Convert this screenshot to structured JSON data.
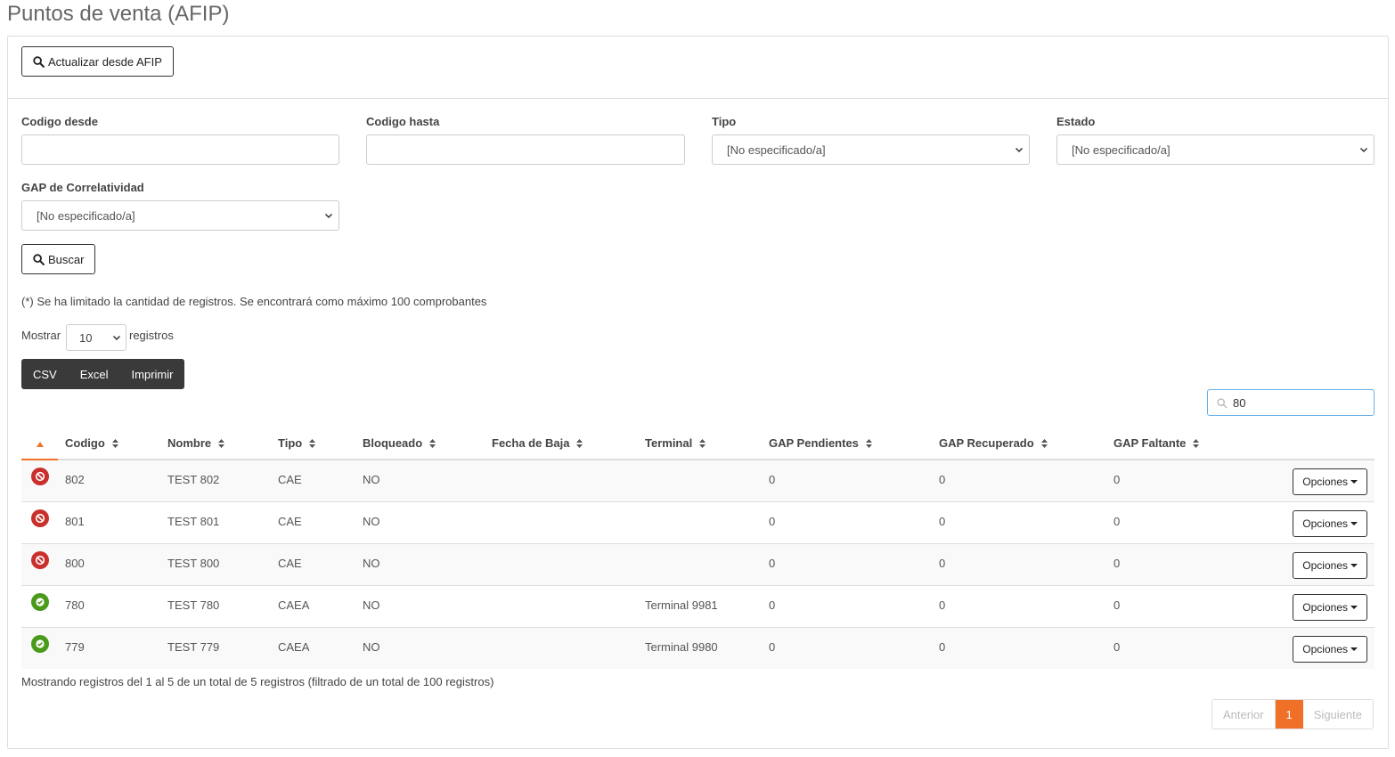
{
  "page": {
    "title": "Puntos de venta (AFIP)"
  },
  "header": {
    "update_button": "Actualizar desde AFIP"
  },
  "filters": {
    "codigo_desde": {
      "label": "Codigo desde",
      "value": ""
    },
    "codigo_hasta": {
      "label": "Codigo hasta",
      "value": ""
    },
    "tipo": {
      "label": "Tipo",
      "selected": "[No especificado/a]"
    },
    "estado": {
      "label": "Estado",
      "selected": "[No especificado/a]"
    },
    "gap": {
      "label": "GAP de Correlatividad",
      "selected": "[No especificado/a]"
    },
    "search_button": "Buscar"
  },
  "note": "(*) Se ha limitado la cantidad de registros. Se encontrará como máximo 100 comprobantes",
  "length": {
    "prefix": "Mostrar",
    "value": "10",
    "suffix": "registros"
  },
  "export": {
    "csv": "CSV",
    "excel": "Excel",
    "print": "Imprimir"
  },
  "search": {
    "value": "80"
  },
  "table": {
    "headers": [
      "Codigo",
      "Nombre",
      "Tipo",
      "Bloqueado",
      "Fecha de Baja",
      "Terminal",
      "GAP Pendientes",
      "GAP Recuperado",
      "GAP Faltante"
    ],
    "options_label": "Opciones",
    "rows": [
      {
        "status": "blocked",
        "codigo": "802",
        "nombre": "TEST 802",
        "tipo": "CAE",
        "bloqueado": "NO",
        "fecha_baja": "",
        "terminal": "",
        "gap_pend": "0",
        "gap_rec": "0",
        "gap_falt": "0"
      },
      {
        "status": "blocked",
        "codigo": "801",
        "nombre": "TEST 801",
        "tipo": "CAE",
        "bloqueado": "NO",
        "fecha_baja": "",
        "terminal": "",
        "gap_pend": "0",
        "gap_rec": "0",
        "gap_falt": "0"
      },
      {
        "status": "blocked",
        "codigo": "800",
        "nombre": "TEST 800",
        "tipo": "CAE",
        "bloqueado": "NO",
        "fecha_baja": "",
        "terminal": "",
        "gap_pend": "0",
        "gap_rec": "0",
        "gap_falt": "0"
      },
      {
        "status": "active",
        "codigo": "780",
        "nombre": "TEST 780",
        "tipo": "CAEA",
        "bloqueado": "NO",
        "fecha_baja": "",
        "terminal": "Terminal 9981",
        "gap_pend": "0",
        "gap_rec": "0",
        "gap_falt": "0"
      },
      {
        "status": "active",
        "codigo": "779",
        "nombre": "TEST 779",
        "tipo": "CAEA",
        "bloqueado": "NO",
        "fecha_baja": "",
        "terminal": "Terminal 9980",
        "gap_pend": "0",
        "gap_rec": "0",
        "gap_falt": "0"
      }
    ]
  },
  "info": "Mostrando registros del 1 al 5 de un total de 5 registros (filtrado de un total de 100 registros)",
  "pagination": {
    "prev": "Anterior",
    "current": "1",
    "next": "Siguiente"
  },
  "colors": {
    "accent": "#f07028",
    "blocked": "#c9302c",
    "active": "#4a9a1c"
  },
  "icons": {
    "blocked": "ban-icon",
    "active": "check-circle-icon"
  }
}
